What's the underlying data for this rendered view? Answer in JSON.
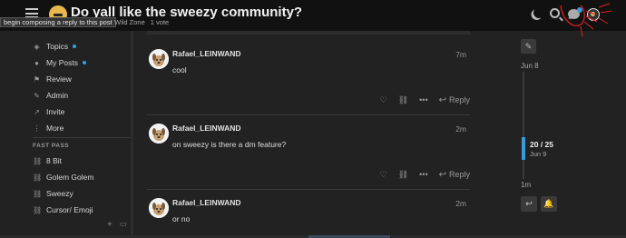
{
  "header": {
    "title": "Do yall like the sweezy community?",
    "tooltip": "begin composing a reply to this post",
    "category": "Wild Zone",
    "votes": "1 vote",
    "icons": [
      "menu-icon",
      "logo-icon",
      "moon-icon",
      "search-icon",
      "chat-icon",
      "user-avatar"
    ]
  },
  "sidebar": {
    "items": [
      {
        "label": "Topics",
        "icon": "topics-icon",
        "unread": true
      },
      {
        "label": "My Posts",
        "icon": "user-icon",
        "unread": true
      },
      {
        "label": "Review",
        "icon": "flag-icon",
        "unread": false
      },
      {
        "label": "Admin",
        "icon": "wrench-icon",
        "unread": false
      },
      {
        "label": "Invite",
        "icon": "invite-icon",
        "unread": false
      },
      {
        "label": "More",
        "icon": "more-icon",
        "unread": false
      }
    ],
    "section_title": "FAST PASS",
    "links": [
      {
        "label": "8 Bit"
      },
      {
        "label": "Golem Golem"
      },
      {
        "label": "Sweezy"
      },
      {
        "label": "Cursor/ Emoji"
      }
    ],
    "footer": {
      "add": "+",
      "collapse": "▭"
    }
  },
  "posts": [
    {
      "author": "Rafael_LEINWAND",
      "time": "7m",
      "body": "cool",
      "reply_label": "Reply"
    },
    {
      "author": "Rafael_LEINWAND",
      "time": "2m",
      "body": "on sweezy is there a dm feature?",
      "reply_label": "Reply"
    },
    {
      "author": "Rafael_LEINWAND",
      "time": "2m",
      "body": "or no",
      "reply_label": "Reply"
    }
  ],
  "timeline": {
    "start_date": "Jun 8",
    "position": "20 / 25",
    "position_date": "Jun 9",
    "end_label": "1m",
    "progress": 0.8
  },
  "colors": {
    "accent": "#3d9ad6",
    "background": "#222222",
    "header": "#111111",
    "annotation": "#e02020"
  }
}
